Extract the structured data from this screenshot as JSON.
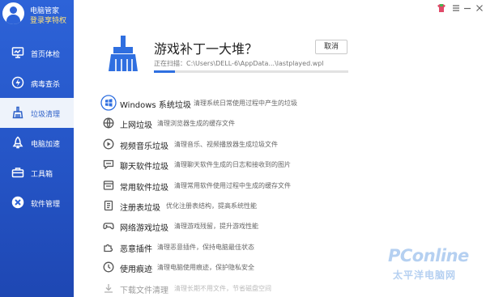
{
  "app": {
    "title": "电脑管家",
    "login_text": "登录享特权"
  },
  "sidebar": {
    "items": [
      {
        "label": "首页体检",
        "icon": "monitor-icon",
        "active": false
      },
      {
        "label": "病毒查杀",
        "icon": "lightning-shield-icon",
        "active": false
      },
      {
        "label": "垃圾清理",
        "icon": "broom-icon",
        "active": true
      },
      {
        "label": "电脑加速",
        "icon": "rocket-icon",
        "active": false
      },
      {
        "label": "工具箱",
        "icon": "toolbox-icon",
        "active": false
      },
      {
        "label": "软件管理",
        "icon": "apps-icon",
        "active": false
      }
    ]
  },
  "window_controls": [
    "skin-icon",
    "menu-icon",
    "minimize-icon",
    "close-icon"
  ],
  "scan": {
    "title": "游戏补丁一大堆？",
    "cancel_label": "取消",
    "path": "正在扫描：C:\\Users\\DELL-6\\AppData...\\lastplayed.wpl",
    "progress": 0.11
  },
  "items": [
    {
      "name": "Windows 系统垃圾",
      "desc": "清理系统日常使用过程中产生的垃圾",
      "icon": "windows-icon"
    },
    {
      "name": "上网垃圾",
      "desc": "清理浏览器生成的缓存文件",
      "icon": "globe-icon"
    },
    {
      "name": "视频音乐垃圾",
      "desc": "清理音乐、视频播放器生成垃圾文件",
      "icon": "play-icon"
    },
    {
      "name": "聊天软件垃圾",
      "desc": "清理聊天软件生成的日志和接收到的图片",
      "icon": "chat-icon"
    },
    {
      "name": "常用软件垃圾",
      "desc": "清理常用软件使用过程中生成的缓存文件",
      "icon": "app-window-icon"
    },
    {
      "name": "注册表垃圾",
      "desc": "优化注册表结构，提高系统性能",
      "icon": "registry-icon"
    },
    {
      "name": "网络游戏垃圾",
      "desc": "清理游戏残留，提升游戏性能",
      "icon": "gamepad-icon"
    },
    {
      "name": "恶意插件",
      "desc": "清理恶意插件，保持电脑最佳状态",
      "icon": "puzzle-icon"
    },
    {
      "name": "使用痕迹",
      "desc": "清理电脑使用痕迹，保护隐私安全",
      "icon": "clock-icon"
    },
    {
      "name": "下载文件清理",
      "desc": "清理长期不用文件，节省磁盘空间",
      "icon": "download-icon"
    }
  ],
  "watermark": {
    "brand": "PConline",
    "sub": "太平洋电脑网"
  },
  "colors": {
    "sidebar": "#2d63d8",
    "active_item_bg": "#eef3fb",
    "accent": "#2f6fe0",
    "login_text": "#ffe27a"
  }
}
